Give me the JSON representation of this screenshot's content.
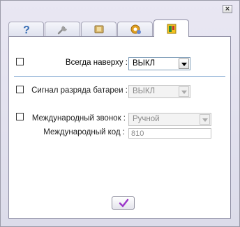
{
  "window": {
    "close_label": "×"
  },
  "tabs": [
    {
      "name": "help",
      "icon": "question-icon"
    },
    {
      "name": "tools",
      "icon": "wrench-icon"
    },
    {
      "name": "battery",
      "icon": "battery-icon"
    },
    {
      "name": "settings",
      "icon": "gear-icon"
    },
    {
      "name": "device",
      "icon": "phone-icon",
      "active": true
    }
  ],
  "settings": {
    "always_on_top": {
      "label": "Всегда наверху :",
      "value": "ВЫКЛ"
    },
    "battery_signal": {
      "label": "Сигнал разряда батареи :",
      "value": "ВЫКЛ"
    },
    "intl_call": {
      "label": "Международный звонок :",
      "value": "Ручной"
    },
    "intl_code": {
      "label": "Международный код :",
      "value": "810"
    }
  },
  "colors": {
    "accent": "#7ea6d0",
    "ok_check": "#9b36c9"
  }
}
